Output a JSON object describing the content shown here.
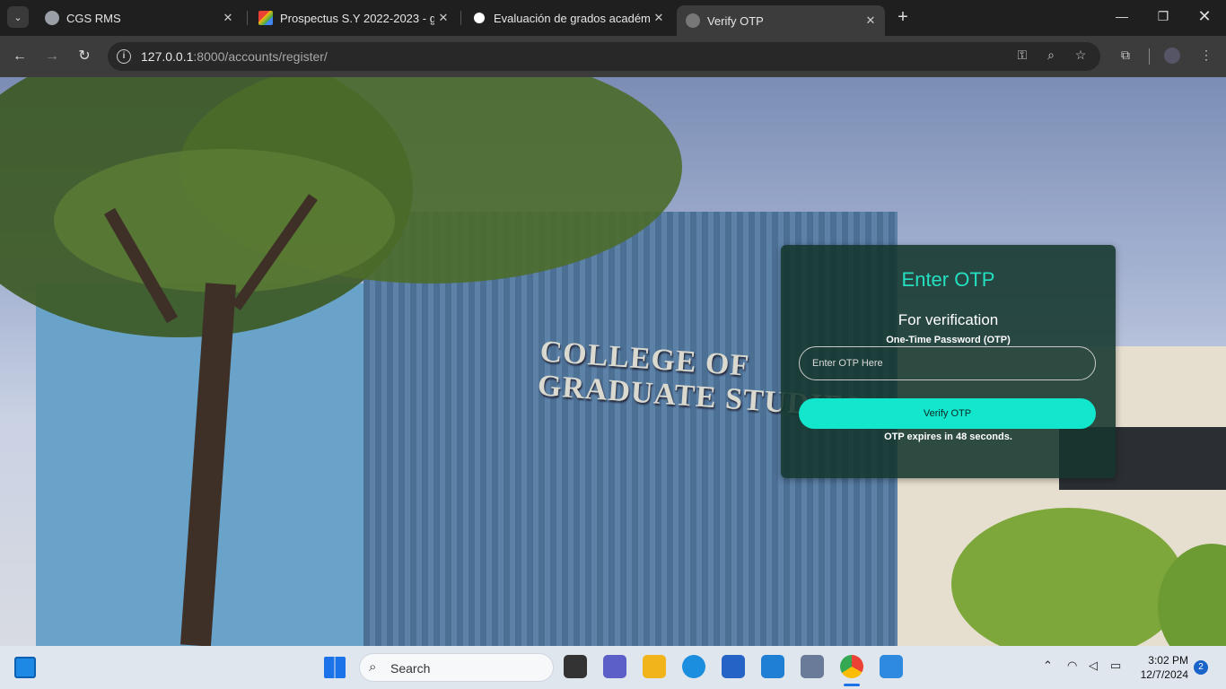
{
  "browser": {
    "tabs": [
      {
        "title": "CGS RMS",
        "active": false
      },
      {
        "title": "Prospectus S.Y 2022-2023 - guz",
        "active": false
      },
      {
        "title": "Evaluación de grados académic",
        "active": false
      },
      {
        "title": "Verify OTP",
        "active": true
      }
    ],
    "new_tab": "+",
    "url_host": "127.0.0.1",
    "url_rest": ":8000/accounts/register/"
  },
  "page": {
    "sign_line1": "COLLEGE OF",
    "sign_line2": "GRADUATE STUDIES",
    "card": {
      "title": "Enter OTP",
      "subtitle": "For verification",
      "field_label": "One-Time Password (OTP)",
      "input_placeholder": "Enter OTP Here",
      "input_value": "",
      "button_label": "Verify OTP",
      "expiry_text": "OTP expires in 48 seconds."
    },
    "colors": {
      "accent": "#12e6cc",
      "title": "#25e0c0",
      "card_bg": "#14372d"
    }
  },
  "taskbar": {
    "search_label": "Search",
    "time": "3:02 PM",
    "date": "12/7/2024",
    "notification_count": "2"
  }
}
